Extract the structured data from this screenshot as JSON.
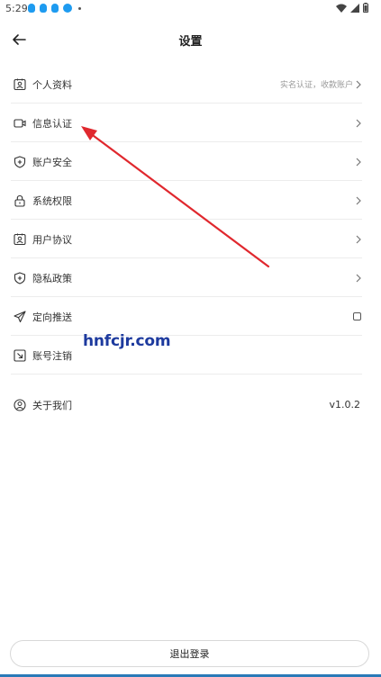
{
  "status_bar": {
    "time": "5:29",
    "notification_icons": [
      "qq-icon",
      "qq-icon",
      "qq-icon",
      "app-badge-icon"
    ],
    "system_icons": [
      "wifi-icon",
      "signal-icon",
      "battery-icon"
    ]
  },
  "header": {
    "title": "设置",
    "back_icon": "arrow-left-icon"
  },
  "settings": {
    "items": [
      {
        "label": "个人资料",
        "icon": "id-card-icon",
        "hint": "实名认证，收款账户"
      },
      {
        "label": "信息认证",
        "icon": "camera-icon"
      },
      {
        "label": "账户安全",
        "icon": "shield-plus-icon"
      },
      {
        "label": "系统权限",
        "icon": "lock-icon"
      },
      {
        "label": "用户协议",
        "icon": "id-card-icon"
      },
      {
        "label": "隐私政策",
        "icon": "shield-plus-icon"
      },
      {
        "label": "定向推送",
        "icon": "paper-plane-icon",
        "toggle": "off"
      },
      {
        "label": "账号注销",
        "icon": "exit-box-icon"
      }
    ],
    "about": {
      "label": "关于我们",
      "icon": "user-circle-icon",
      "version": "v1.0.2"
    }
  },
  "watermark": "hnfcjr.com",
  "logout_label": "退出登录",
  "colors": {
    "annotation_arrow": "#e0282e",
    "watermark": "#1d3a9e",
    "notification_icon": "#1e9bf0"
  }
}
